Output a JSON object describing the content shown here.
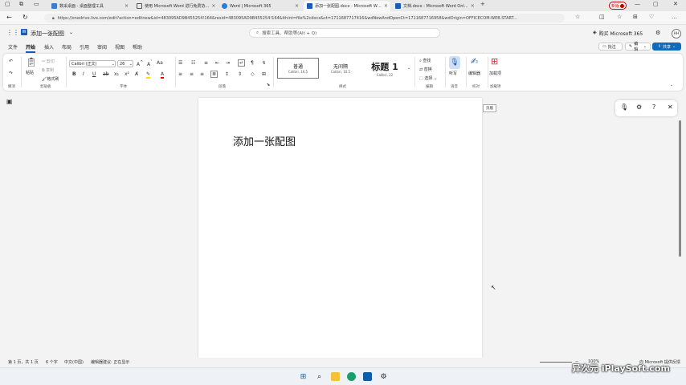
{
  "browser": {
    "tabs": [
      {
        "title": "数采桌面 - 桌面整理工具"
      },
      {
        "title": "使用 Microsoft Word 进行免费协…"
      },
      {
        "title": "Word | Microsoft 365"
      },
      {
        "title": "添加一张配图.docx - Microsoft W…"
      },
      {
        "title": "文档.docx - Microsoft Word Onl…"
      }
    ],
    "new_label": "新版",
    "url": "https://onedrive.live.com/edit?action=editnew&id=483095AD9B455254!164&resid=483095AD9B455254!164&ithint=file%2cdocx&ct=1711687717416&wdNewAndOpenCt=1711687716958&wdOrigin=OFFICECOM-WEB.START..."
  },
  "office": {
    "doc_title": "添加一张配图",
    "search_placeholder": "搜索工具、帮助等(Alt + Q)",
    "buy_label": "购买 Microsoft 365",
    "avatar": "HH"
  },
  "menu": {
    "tabs": [
      "文件",
      "开始",
      "插入",
      "布局",
      "引用",
      "审阅",
      "视图",
      "帮助"
    ],
    "comment_label": "批注",
    "edit_label": "编辑",
    "share_label": "共享"
  },
  "ribbon": {
    "undo_group": "撤消",
    "paste": "粘贴",
    "cut": "剪切",
    "copy": "复制",
    "format_painter": "格式刷",
    "clipboard_group": "剪贴板",
    "font_name": "Calibri (正文)",
    "font_size": "26",
    "font_group": "字体",
    "paragraph_group": "段落",
    "styles": [
      {
        "name": "普通",
        "sub": "Calibri, 10.5"
      },
      {
        "name": "无间隔",
        "sub": "Calibri, 10.5"
      },
      {
        "name": "标题 1",
        "sub": "Calibri, 22"
      }
    ],
    "styles_group": "样式",
    "find": "查找",
    "replace": "替换",
    "select": "选择",
    "editing_group": "编辑",
    "dictate": "听写",
    "voice_group": "语音",
    "editor": "编辑器",
    "proofing_group": "校对",
    "addins": "加载项",
    "addins_group": "加载项"
  },
  "document": {
    "body_text": "添加一张配图",
    "page_badge": "页眉"
  },
  "status": {
    "page": "第 1 页，共 1 页",
    "words": "6 个字",
    "language": "中文(中国)",
    "editor_hint": "编辑器建议: 正在显示",
    "zoom": "100%",
    "feedback": "向 Microsoft 提供反馈"
  },
  "watermark": "异次元 iPlaySoft.com",
  "colors": {
    "accent": "#185abd",
    "share": "#0f6cbd"
  }
}
